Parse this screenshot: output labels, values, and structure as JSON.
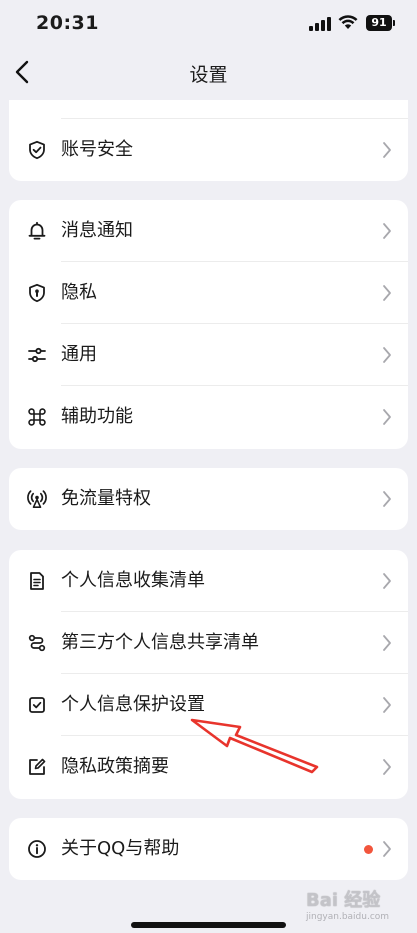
{
  "status_bar": {
    "time": "20:31",
    "battery": "91"
  },
  "nav": {
    "title": "设置"
  },
  "sections": {
    "account": [
      {
        "label": "账号安全",
        "icon": "shield-check-icon"
      }
    ],
    "general": [
      {
        "label": "消息通知",
        "icon": "bell-icon"
      },
      {
        "label": "隐私",
        "icon": "privacy-shield-icon"
      },
      {
        "label": "通用",
        "icon": "sliders-icon"
      },
      {
        "label": "辅助功能",
        "icon": "command-icon"
      }
    ],
    "data": [
      {
        "label": "免流量特权",
        "icon": "antenna-icon"
      }
    ],
    "personal_info": [
      {
        "label": "个人信息收集清单",
        "icon": "document-list-icon"
      },
      {
        "label": "第三方个人信息共享清单",
        "icon": "share-icon"
      },
      {
        "label": "个人信息保护设置",
        "icon": "checkbox-icon"
      },
      {
        "label": "隐私政策摘要",
        "icon": "edit-icon"
      }
    ],
    "about": [
      {
        "label": "关于QQ与帮助",
        "icon": "info-icon",
        "badge": "red-dot",
        "badge_color": "#f2553c"
      }
    ]
  },
  "annotation": {
    "color": "#e8342c"
  },
  "watermark": {
    "text": "Bai 经验",
    "sub": "jingyan.baidu.com"
  }
}
